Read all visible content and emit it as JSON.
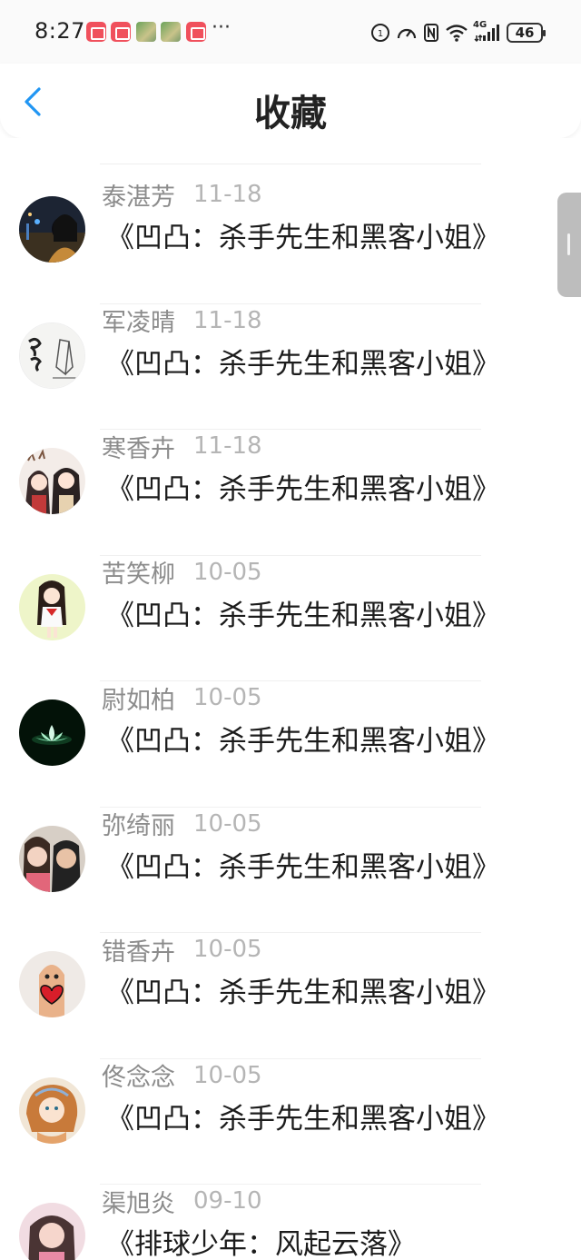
{
  "status_bar": {
    "time": "8:27",
    "more": "···",
    "network": "4G",
    "battery": "46"
  },
  "header": {
    "title": "收藏",
    "back_icon": "chevron-left-icon"
  },
  "colors": {
    "accent": "#2196f3",
    "name": "#8c8c8c",
    "date": "#b5b5b5"
  },
  "items": [
    {
      "name": "泰湛芳",
      "date": "11-18",
      "book": "《凹凸：杀手先生和黑客小姐》",
      "avatar": "night-city-portrait"
    },
    {
      "name": "军凌晴",
      "date": "11-18",
      "book": "《凹凸：杀手先生和黑客小姐》",
      "avatar": "calligraphy-hands"
    },
    {
      "name": "寒香卉",
      "date": "11-18",
      "book": "《凹凸：杀手先生和黑客小姐》",
      "avatar": "anime-couple"
    },
    {
      "name": "苦笑柳",
      "date": "10-05",
      "book": "《凹凸：杀手先生和黑客小姐》",
      "avatar": "cartoon-girl"
    },
    {
      "name": "尉如柏",
      "date": "10-05",
      "book": "《凹凸：杀手先生和黑客小姐》",
      "avatar": "lotus-dark"
    },
    {
      "name": "弥绮丽",
      "date": "10-05",
      "book": "《凹凸：杀手先生和黑客小姐》",
      "avatar": "couple-photo"
    },
    {
      "name": "错香卉",
      "date": "10-05",
      "book": "《凹凸：杀手先生和黑客小姐》",
      "avatar": "finger-heart"
    },
    {
      "name": "佟念念",
      "date": "10-05",
      "book": "《凹凸：杀手先生和黑客小姐》",
      "avatar": "painted-girl"
    },
    {
      "name": "渠旭炎",
      "date": "09-10",
      "book": "《排球少年：风起云落》",
      "avatar": "pink-portrait"
    }
  ]
}
